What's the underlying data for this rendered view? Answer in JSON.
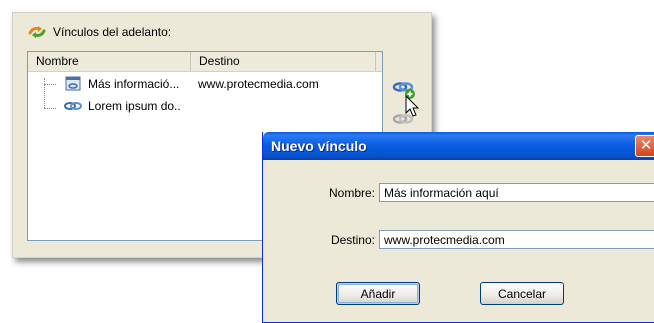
{
  "panel": {
    "header_label": "Vínculos del adelanto:",
    "columns": [
      "Nombre",
      "Destino"
    ],
    "rows": [
      {
        "name": "Más informació...",
        "dest": "www.protecmedia.com"
      },
      {
        "name": "Lorem ipsum do..",
        "dest": ""
      }
    ],
    "icons": {
      "header": "links-icon",
      "add_link": "add-link-icon",
      "remove_link": "remove-link-icon"
    }
  },
  "dialog": {
    "title": "Nuevo vínculo",
    "close_glyph": "✕",
    "nombre_label": "Nombre:",
    "nombre_value": "Más información aquí",
    "destino_label": "Destino:",
    "destino_value": "www.protecmedia.com",
    "add_label": "Añadir",
    "cancel_label": "Cancelar"
  },
  "colors": {
    "titlebar": "#0453d0",
    "panel_bg": "#ece9d8",
    "close": "#d0441f"
  }
}
